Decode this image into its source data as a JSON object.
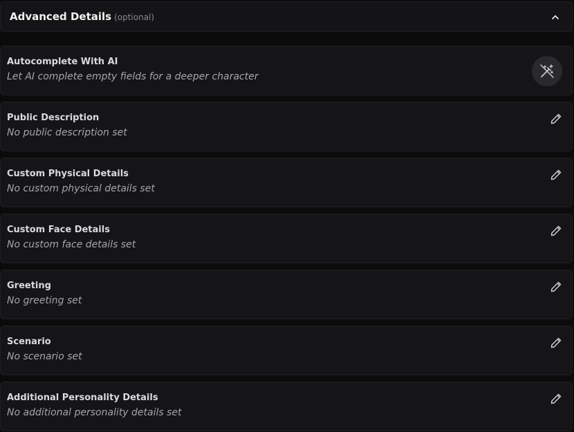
{
  "header": {
    "title": "Advanced Details",
    "optional_label": "(optional)",
    "toggle_icon": "chevron-up-icon"
  },
  "autocomplete": {
    "label": "Autocomplete With AI",
    "description": "Let AI complete empty fields for a deeper character",
    "icon": "magic-wand-icon"
  },
  "fields": [
    {
      "label": "Public Description",
      "value": "No public description set",
      "icon": "pencil-icon"
    },
    {
      "label": "Custom Physical Details",
      "value": "No custom physical details set",
      "icon": "pencil-icon"
    },
    {
      "label": "Custom Face Details",
      "value": "No custom face details set",
      "icon": "pencil-icon"
    },
    {
      "label": "Greeting",
      "value": "No greeting set",
      "icon": "pencil-icon"
    },
    {
      "label": "Scenario",
      "value": "No scenario set",
      "icon": "pencil-icon"
    },
    {
      "label": "Additional Personality Details",
      "value": "No additional personality details set",
      "icon": "pencil-icon"
    }
  ]
}
